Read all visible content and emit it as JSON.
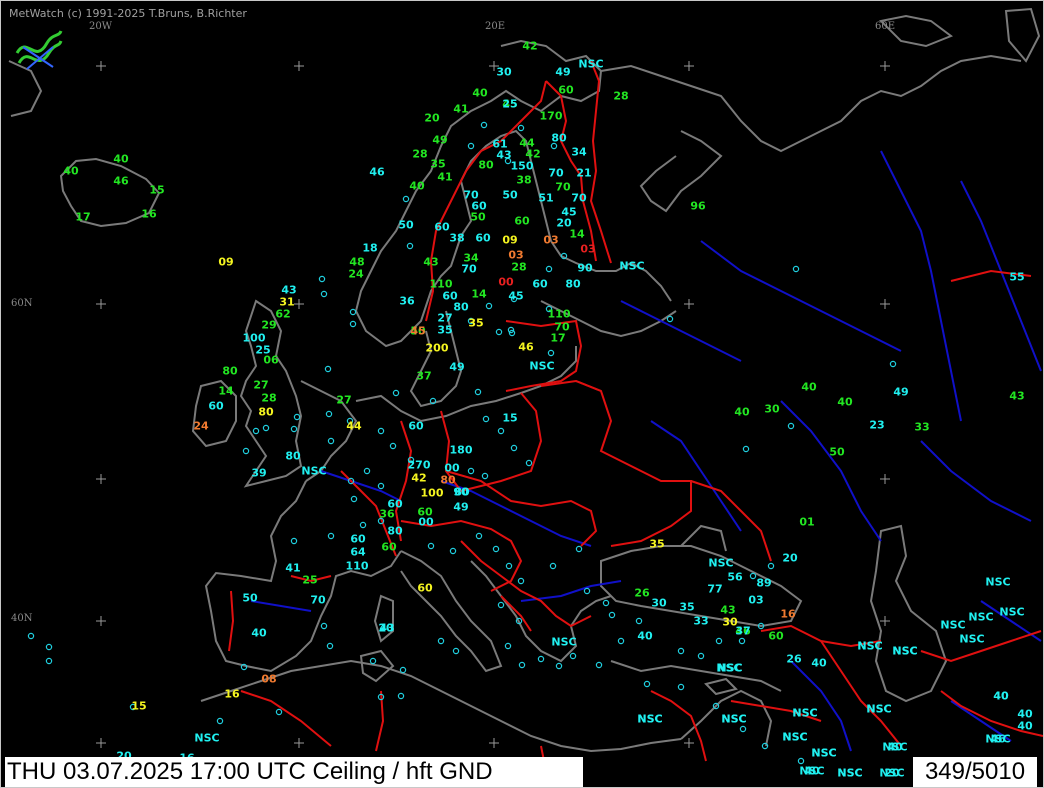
{
  "header": {
    "credit": "MetWatch  (c) 1991-2025 T.Bruns, B.Richter"
  },
  "graticule_labels": [
    {
      "key": "w20",
      "text": "20W"
    },
    {
      "key": "e20",
      "text": "20E"
    },
    {
      "key": "e60",
      "text": "60E"
    },
    {
      "key": "n60",
      "text": "60N"
    },
    {
      "key": "n40",
      "text": "40N"
    }
  ],
  "colors": {
    "background": "#000000",
    "coast": "#7a7a7a",
    "border": "#e01010",
    "river": "#1010c8",
    "green": "#22e622",
    "cyan": "#20f0f0",
    "yellow": "#f5f520",
    "orange": "#f07a30",
    "red": "#e82020"
  },
  "observations": [
    "42",
    "30",
    "NSC",
    "49",
    "60",
    "28",
    "45",
    "40",
    "20",
    "41",
    "170",
    "80",
    "49",
    "61",
    "44",
    "43",
    "42",
    "28",
    "35",
    "80",
    "150",
    "34",
    "41",
    "38",
    "70",
    "21",
    "70",
    "70",
    "70",
    "51",
    "60",
    "50",
    "45",
    "50",
    "60",
    "20",
    "60",
    "60",
    "38",
    "14",
    "09",
    "03",
    "03",
    "03",
    "NSC",
    "34",
    "28",
    "90",
    "43",
    "70",
    "00",
    "60",
    "80",
    "45",
    "110",
    "60",
    "14",
    "80",
    "35",
    "27",
    "110",
    "70",
    "50",
    "35",
    "200",
    "17",
    "NSC",
    "46",
    "37",
    "49",
    "15",
    "60",
    "180",
    "270",
    "00",
    "80",
    "42",
    "80",
    "100",
    "90",
    "60",
    "60",
    "49",
    "36",
    "80",
    "00",
    "60",
    "60",
    "64",
    "110",
    "35",
    "NSC",
    "56",
    "77",
    "89",
    "43",
    "03",
    "16",
    "30",
    "46",
    "60",
    "26",
    "40",
    "33",
    "35",
    "30",
    "26",
    "40",
    "NSC",
    "NSC",
    "NSC",
    "NSC",
    "NSC",
    "NSC",
    "NSC",
    "NSC",
    "NSC",
    "NSC",
    "NSC",
    "NSC",
    "NSC",
    "NSC",
    "NSC",
    "40",
    "40",
    "40",
    "NSC",
    "NSC",
    "20",
    "40",
    "43",
    "40",
    "40",
    "30",
    "40",
    "23",
    "49",
    "33",
    "50",
    "43",
    "01",
    "20",
    "55",
    "96",
    "40",
    "40",
    "46",
    "15",
    "17",
    "16",
    "09",
    "43",
    "31",
    "62",
    "29",
    "18",
    "48",
    "24",
    "36",
    "27",
    "25",
    "100",
    "80",
    "06",
    "14",
    "27",
    "28",
    "60",
    "80",
    "24",
    "44",
    "80",
    "NSC",
    "39",
    "41",
    "25",
    "50",
    "70",
    "40",
    "20",
    "60",
    "08",
    "16",
    "15",
    "16",
    "20",
    "NSC",
    "NSC",
    "NSC",
    "NSC",
    "NSC",
    "NSC",
    "NSC",
    "NSC",
    "NSC",
    "NSC",
    "NSC",
    "NSC",
    "NSC",
    "NSC",
    "40",
    "40",
    "46",
    "37",
    "50",
    "45",
    "25",
    "40",
    "46"
  ],
  "footer": {
    "left": "THU 03.07.2025 17:00 UTC     Ceiling / hft GND",
    "right": "349/5010"
  }
}
